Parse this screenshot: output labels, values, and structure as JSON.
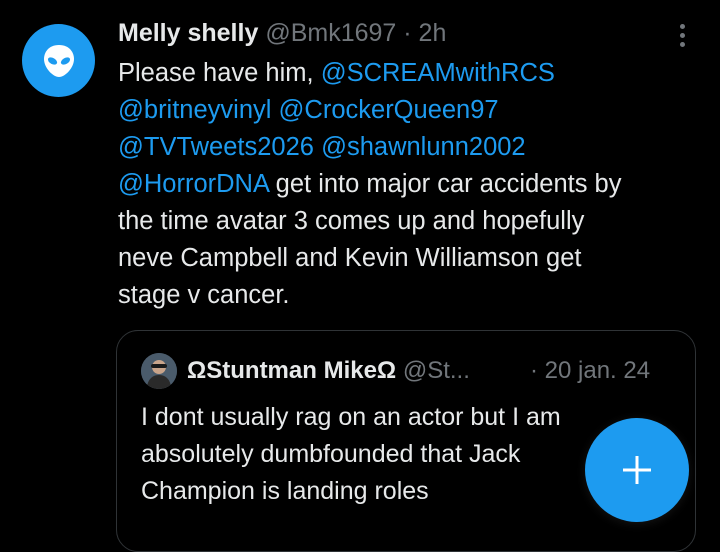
{
  "tweet": {
    "display_name": "Melly shelly",
    "handle": "@Bmk1697",
    "separator": "·",
    "time": "2h",
    "body_lines": [
      [
        {
          "t": "text",
          "v": "Please have him, "
        },
        {
          "t": "mention",
          "v": "@SCREAMwithRCS"
        }
      ],
      [
        {
          "t": "mention",
          "v": "@britneyvinyl"
        },
        {
          "t": "text",
          "v": " "
        },
        {
          "t": "mention",
          "v": "@CrockerQueen97"
        }
      ],
      [
        {
          "t": "mention",
          "v": "@TVTweets2026"
        },
        {
          "t": "text",
          "v": " "
        },
        {
          "t": "mention",
          "v": "@shawnlunn2002"
        }
      ],
      [
        {
          "t": "mention",
          "v": "@HorrorDNA"
        },
        {
          "t": "text",
          "v": " get into major car accidents by"
        }
      ],
      [
        {
          "t": "text",
          "v": "the time avatar 3 comes up and hopefully"
        }
      ],
      [
        {
          "t": "text",
          "v": "neve Campbell and Kevin Williamson get"
        }
      ],
      [
        {
          "t": "text",
          "v": "stage v cancer."
        }
      ]
    ]
  },
  "quoted_tweet": {
    "display_name": "ΩStuntman MikeΩ",
    "handle": "@St...",
    "time": "· 20 jan. 24",
    "body_lines": [
      "I dont usually rag on an actor but I am",
      "absolutely dumbfounded that Jack",
      "Champion is landing roles"
    ]
  },
  "icons": {
    "avatar": "alien-icon",
    "more": "more-options-icon",
    "compose": "plus-icon"
  },
  "colors": {
    "background": "#000000",
    "text": "#e7e9ea",
    "secondary": "#71767b",
    "accent": "#1d9bf0",
    "border": "#2f3336"
  }
}
